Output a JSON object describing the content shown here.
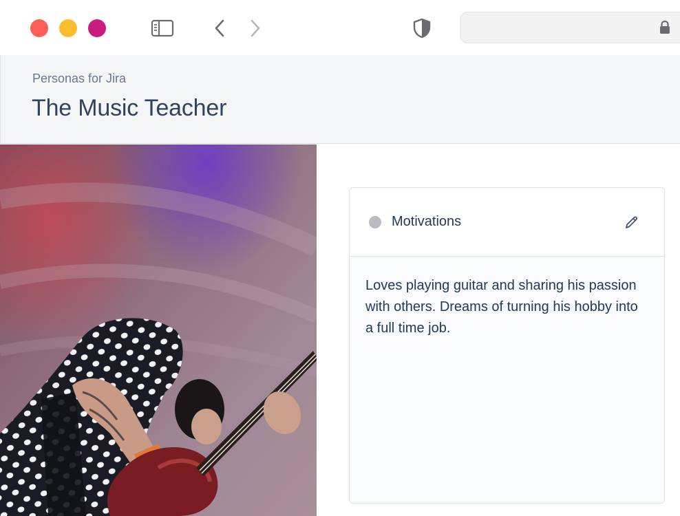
{
  "browser": {
    "icons": {
      "sidebar": "sidebar-toggle-icon",
      "back": "chevron-left-icon",
      "forward": "chevron-right-icon",
      "privacy": "shield-icon",
      "secure": "lock-icon"
    },
    "traffic_lights": {
      "close": "#fe5f57",
      "minimize": "#fbbc2e",
      "zoom": "#c81c7f"
    }
  },
  "header": {
    "breadcrumb": "Personas for Jira",
    "title": "The Music Teacher"
  },
  "persona": {
    "photo": "guitarist-photo"
  },
  "card": {
    "title": "Motivations",
    "status_color": "#b9bcc2",
    "edit_icon": "pencil-icon",
    "body": "Loves playing guitar and sharing his passion with others. Dreams of turning his hobby into a full time job."
  }
}
